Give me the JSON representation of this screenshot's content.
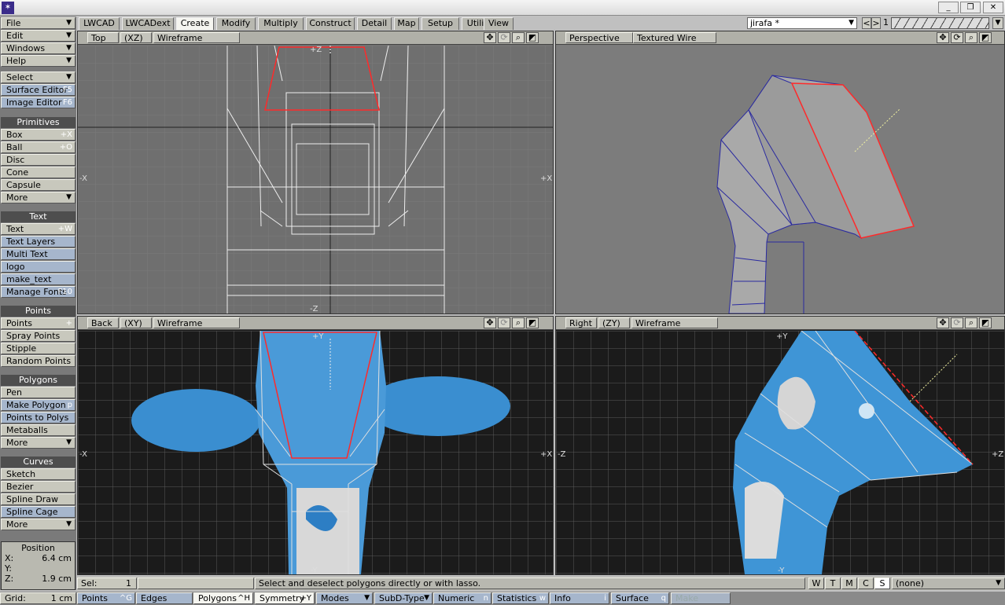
{
  "app": {
    "title": ""
  },
  "menu": [
    {
      "label": "File",
      "dropdown": true
    },
    {
      "label": "Edit",
      "dropdown": true
    },
    {
      "label": "Windows",
      "dropdown": true
    },
    {
      "label": "Help",
      "dropdown": true
    }
  ],
  "left": {
    "select": "Select",
    "surface_editor": {
      "label": "Surface Editor",
      "shortcut": "F5"
    },
    "image_editor": {
      "label": "Image Editor",
      "shortcut": "F6"
    },
    "primitives": {
      "header": "Primitives",
      "items": [
        {
          "label": "Box",
          "shortcut": "+X"
        },
        {
          "label": "Ball",
          "shortcut": "+O"
        },
        {
          "label": "Disc",
          "shortcut": ""
        },
        {
          "label": "Cone",
          "shortcut": ""
        },
        {
          "label": "Capsule",
          "shortcut": ""
        },
        {
          "label": "More",
          "shortcut": ""
        }
      ]
    },
    "text": {
      "header": "Text",
      "items": [
        {
          "label": "Text",
          "shortcut": "+W"
        },
        {
          "label": "Text Layers",
          "shortcut": ""
        },
        {
          "label": "Multi Text",
          "shortcut": ""
        },
        {
          "label": "logo",
          "shortcut": ""
        },
        {
          "label": "make_text",
          "shortcut": ""
        },
        {
          "label": "Manage Fonts",
          "shortcut": "F10"
        }
      ]
    },
    "points": {
      "header": "Points",
      "items": [
        {
          "label": "Points",
          "shortcut": "+"
        },
        {
          "label": "Spray Points",
          "shortcut": ""
        },
        {
          "label": "Stipple",
          "shortcut": ""
        },
        {
          "label": "Random Points",
          "shortcut": ""
        }
      ]
    },
    "polygons": {
      "header": "Polygons",
      "items": [
        {
          "label": "Pen",
          "shortcut": ""
        },
        {
          "label": "Make Polygon",
          "shortcut": "p"
        },
        {
          "label": "Points to Polys",
          "shortcut": ""
        },
        {
          "label": "Metaballs",
          "shortcut": ""
        },
        {
          "label": "More",
          "shortcut": ""
        }
      ]
    },
    "curves": {
      "header": "Curves",
      "items": [
        {
          "label": "Sketch",
          "shortcut": ""
        },
        {
          "label": "Bezier",
          "shortcut": ""
        },
        {
          "label": "Spline Draw",
          "shortcut": ""
        },
        {
          "label": "Spline Cage",
          "shortcut": ""
        },
        {
          "label": "More",
          "shortcut": ""
        }
      ]
    },
    "position": {
      "title": "Position",
      "x_label": "X:",
      "x_value": "6.4 cm",
      "y_label": "Y:",
      "y_value": "",
      "z_label": "Z:",
      "z_value": "1.9 cm"
    }
  },
  "tabs": [
    "LWCAD",
    "LWCADext",
    "Create",
    "Modify",
    "Multiply",
    "Construct",
    "Detail",
    "Map",
    "Setup",
    "Utilities",
    "View"
  ],
  "active_tab": "Create",
  "layer_select": "jirafa *",
  "layer_number": "1",
  "viewports": {
    "top": {
      "view": "Top",
      "axis": "(XZ)",
      "mode": "Wireframe"
    },
    "persp": {
      "view": "Perspective",
      "mode": "Textured Wire"
    },
    "back": {
      "view": "Back",
      "axis": "(XY)",
      "mode": "Wireframe"
    },
    "right": {
      "view": "Right",
      "axis": "(ZY)",
      "mode": "Wireframe"
    }
  },
  "axis_labels": {
    "plus_z": "+Z",
    "minus_z": "-Z",
    "plus_x": "+X",
    "minus_x": "-X",
    "plus_y": "+Y",
    "minus_y": "-Y"
  },
  "status": {
    "sel_label": "Sel:",
    "sel_value": "1",
    "hint": "Select and deselect polygons directly or with lasso.",
    "wtmcs": [
      "W",
      "T",
      "M",
      "C",
      "S"
    ],
    "wtmcs_active": "S",
    "surface_select": "(none)"
  },
  "bottom": {
    "grid_label": "Grid:",
    "grid_value": "1 cm",
    "points": {
      "label": "Points",
      "shortcut": "^G"
    },
    "edges": {
      "label": "Edges",
      "shortcut": ""
    },
    "polygons": {
      "label": "Polygons",
      "shortcut": "^H"
    },
    "symmetry": {
      "label": "Symmetry",
      "shortcut": "+Y"
    },
    "modes": "Modes",
    "subd": "SubD-Type",
    "numeric": {
      "label": "Numeric",
      "shortcut": "n"
    },
    "statistics": {
      "label": "Statistics",
      "shortcut": "w"
    },
    "info": {
      "label": "Info",
      "shortcut": "i"
    },
    "surface": {
      "label": "Surface",
      "shortcut": "q"
    },
    "make": "Make"
  },
  "colors": {
    "accent_blue": "#a6b6cc",
    "viewport_grid": "#6f6f6f",
    "textured_bg": "#1b1b1b",
    "selection_red": "#ff2a2a"
  }
}
